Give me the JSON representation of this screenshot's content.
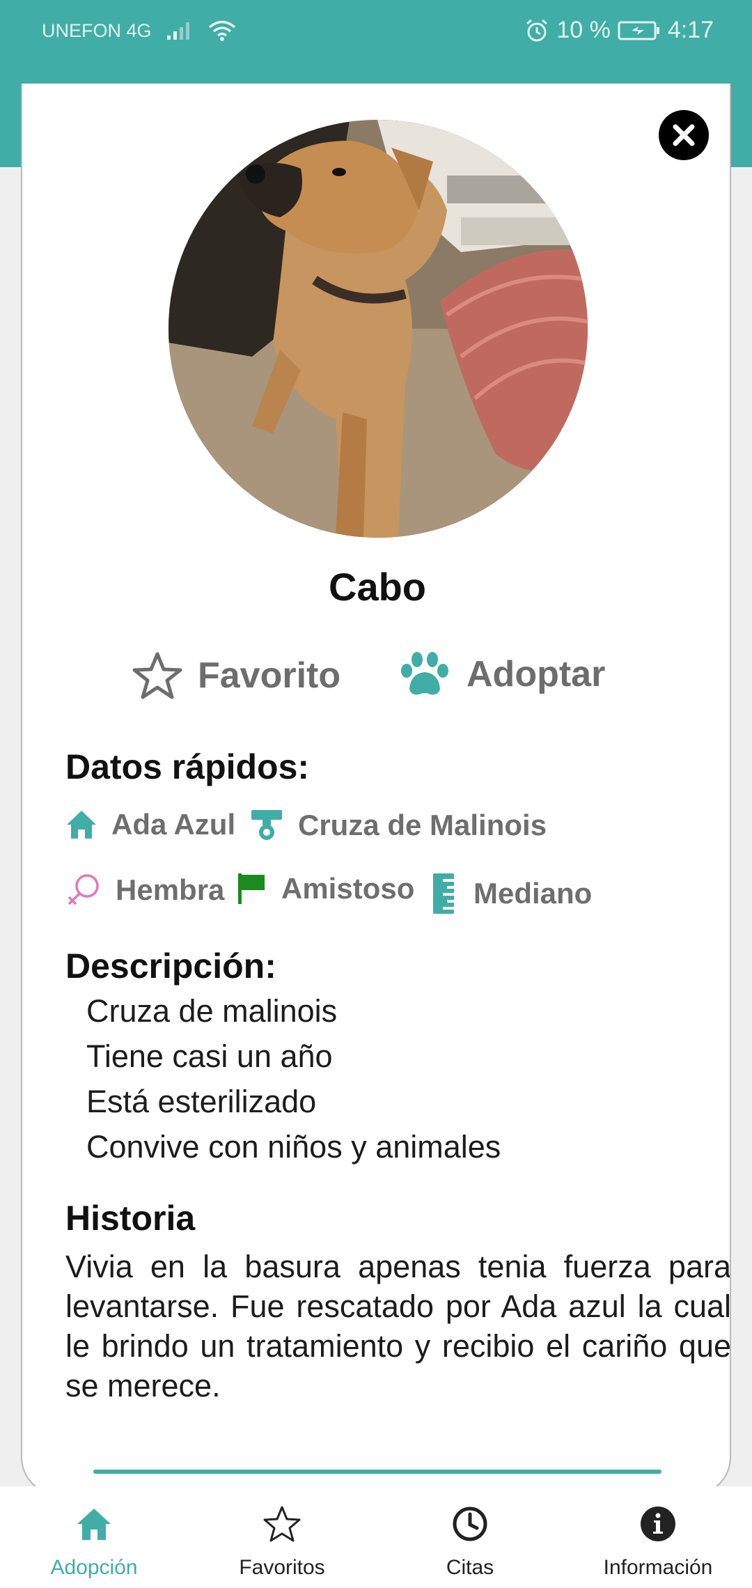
{
  "status": {
    "carrier": "UNEFON 4G",
    "battery": "10 %",
    "time": "4:17"
  },
  "pet": {
    "name": "Cabo",
    "photo_alt": "dog-photo"
  },
  "actions": {
    "favorite_label": "Favorito",
    "adopt_label": "Adoptar"
  },
  "quick_facts": {
    "title": "Datos rápidos:",
    "items": [
      {
        "icon": "home-icon",
        "label": "Ada Azul"
      },
      {
        "icon": "dog-collar-icon",
        "label": "Cruza de Malinois"
      },
      {
        "icon": "female-icon",
        "label": "Hembra"
      },
      {
        "icon": "flag-icon",
        "label": "Amistoso"
      },
      {
        "icon": "ruler-icon",
        "label": "Mediano"
      }
    ]
  },
  "description": {
    "title": "Descripción:",
    "lines": [
      "Cruza de malinois",
      "Tiene casi un año",
      "Está esterilizado",
      "Convive con niños y animales"
    ]
  },
  "history": {
    "title": "Historia",
    "text": "Vivia en la basura apenas tenia fuerza para levantarse. Fue rescatado por Ada azul la cual le brindo un tratamiento y recibio el cariño que se merece."
  },
  "nav": {
    "items": [
      {
        "label": "Adopción",
        "icon": "house-icon",
        "active": true
      },
      {
        "label": "Favoritos",
        "icon": "star-icon",
        "active": false
      },
      {
        "label": "Citas",
        "icon": "clock-icon",
        "active": false
      },
      {
        "label": "Información",
        "icon": "info-icon",
        "active": false
      }
    ]
  },
  "colors": {
    "accent": "#40ada7",
    "female": "#e376b9",
    "flag": "#1c8a1c",
    "text_muted": "#6e6e6e"
  }
}
